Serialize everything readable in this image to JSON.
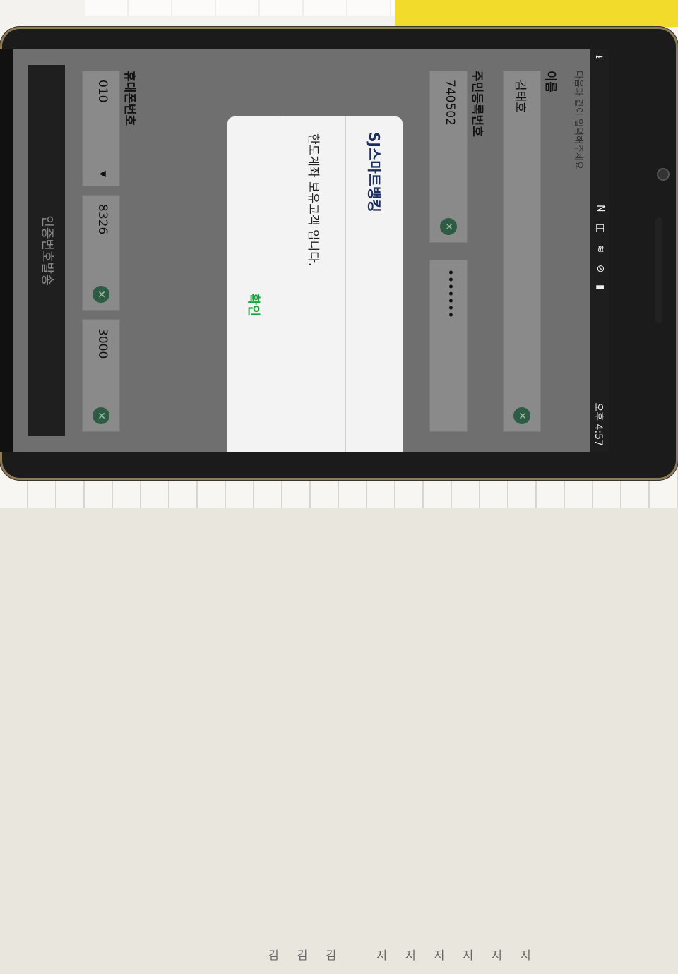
{
  "background": {
    "grid_characters": "김김김 저저저저저저"
  },
  "statusbar": {
    "time": "오후 4:57",
    "icons_text": "N ◫ ≋ ⊘ ▮"
  },
  "form": {
    "top_text": "다음과 같이 입력해주세요",
    "name_label": "이름",
    "name_value": "김태호",
    "id_label": "주민등록번호",
    "id_front": "740502",
    "id_back": "•••••••",
    "phone_label": "휴대폰번호",
    "phone_prefix": "010",
    "phone_mid": "8326",
    "phone_last": "3000",
    "send_button": "인증번호발송"
  },
  "modal": {
    "title": "SJ스마트뱅킹",
    "message": "한도계좌 보유고객 입니다.",
    "ok_label": "확인"
  },
  "colors": {
    "accent_green": "#18a33a",
    "title_navy": "#1a2f5e"
  }
}
